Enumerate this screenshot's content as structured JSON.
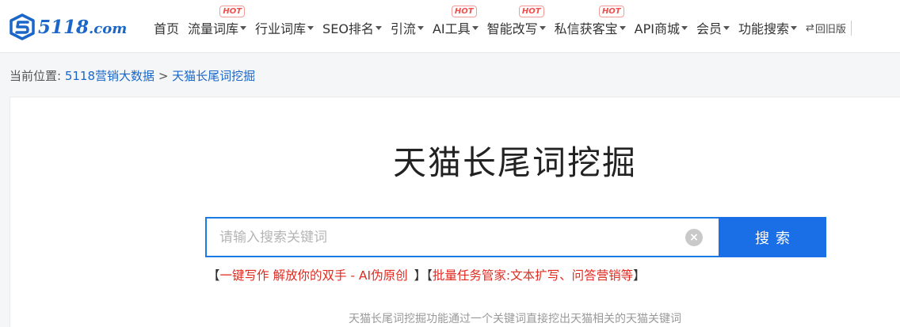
{
  "brand": {
    "logo_text": "5118",
    "logo_suffix": ".com",
    "color": "#1a66c9"
  },
  "nav": {
    "items": [
      {
        "label": "首页",
        "caret": false,
        "hot": false
      },
      {
        "label": "流量词库",
        "caret": true,
        "hot": true
      },
      {
        "label": "行业词库",
        "caret": true,
        "hot": false
      },
      {
        "label": "SEO排名",
        "caret": true,
        "hot": false
      },
      {
        "label": "引流",
        "caret": true,
        "hot": false
      },
      {
        "label": "AI工具",
        "caret": true,
        "hot": true
      },
      {
        "label": "智能改写",
        "caret": true,
        "hot": true
      },
      {
        "label": "私信获客宝",
        "caret": true,
        "hot": true
      },
      {
        "label": "API商城",
        "caret": true,
        "hot": false
      },
      {
        "label": "会员",
        "caret": true,
        "hot": false
      },
      {
        "label": "功能搜索",
        "caret": true,
        "hot": false
      }
    ],
    "hot_label": "HOT",
    "old_version": "回旧版"
  },
  "breadcrumb": {
    "prefix": "当前位置:",
    "link1": "5118营销大数据",
    "separator": ">",
    "link2": "天猫长尾词挖掘"
  },
  "main": {
    "title": "天猫长尾词挖掘",
    "search": {
      "placeholder": "请输入搜索关键词",
      "value": "",
      "button_label": "搜索",
      "clear_icon": "×"
    },
    "promo": {
      "left_bracket": "【",
      "link1": "一键写作 解放你的双手 - AI伪原创",
      "right_bracket": "】",
      "left_bracket2": "【",
      "link2": "批量任务管家:文本扩写、问答营销等",
      "right_bracket2": "】"
    },
    "description": "天猫长尾词挖掘功能通过一个关键词直接挖出天猫相关的天猫关键词"
  }
}
